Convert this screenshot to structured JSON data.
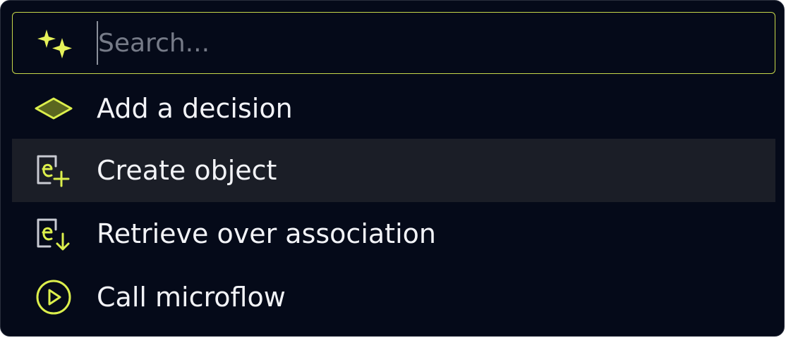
{
  "search": {
    "placeholder": "Search...",
    "value": "",
    "icon": "sparkles-icon"
  },
  "items": [
    {
      "label": "Add a decision",
      "icon": "decision-diamond-icon"
    },
    {
      "label": "Create object",
      "icon": "create-object-icon",
      "highlighted": true
    },
    {
      "label": "Retrieve over association",
      "icon": "retrieve-object-icon"
    },
    {
      "label": "Call microflow",
      "icon": "play-circle-icon"
    }
  ],
  "colors": {
    "background": "#050a19",
    "accent": "#d6ee4c",
    "highlight_row": "#1b1e27",
    "text": "#f2f3f7",
    "icon_gray": "#c8cad2"
  }
}
